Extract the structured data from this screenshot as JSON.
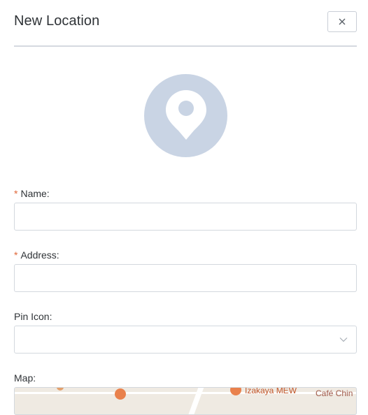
{
  "dialog": {
    "title": "New Location",
    "close_label": "×"
  },
  "avatar": {
    "icon": "map-pin-icon",
    "color": "#c9d4e4"
  },
  "form": {
    "name": {
      "label": "Name:",
      "required_mark": "*",
      "value": "",
      "placeholder": ""
    },
    "address": {
      "label": "Address:",
      "required_mark": "*",
      "value": "",
      "placeholder": ""
    },
    "pin_icon": {
      "label": "Pin Icon:",
      "selected": ""
    },
    "map": {
      "label": "Map:",
      "pois": [
        {
          "name": "Izakaya MEW"
        },
        {
          "name": "Café Chin"
        }
      ]
    }
  },
  "colors": {
    "required": "#e0683a",
    "border": "#d3d8de",
    "divider": "#d5d9e0",
    "text": "#2f3337"
  }
}
